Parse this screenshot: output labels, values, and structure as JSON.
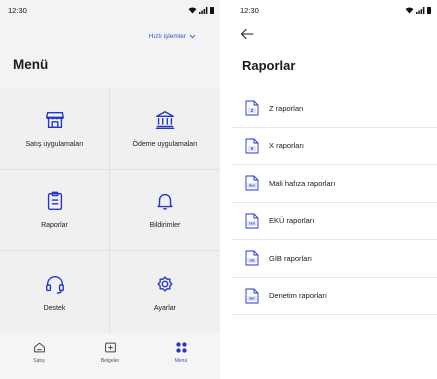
{
  "left_screen": {
    "time": "12:30",
    "quick_actions_label": "Hızlı işlemler",
    "title": "Menü",
    "tiles": [
      {
        "label": "Satış uygulamaları",
        "icon": "store-icon"
      },
      {
        "label": "Ödeme uygulamaları",
        "icon": "bank-icon"
      },
      {
        "label": "Raporlar",
        "icon": "clipboard-icon"
      },
      {
        "label": "Bildirimler",
        "icon": "bell-icon"
      },
      {
        "label": "Destek",
        "icon": "headset-icon"
      },
      {
        "label": "Ayarlar",
        "icon": "gear-icon"
      }
    ],
    "tabs": [
      {
        "label": "Satış",
        "icon": "home-icon",
        "active": false
      },
      {
        "label": "Belgeler",
        "icon": "receipt-icon",
        "active": false
      },
      {
        "label": "Menü",
        "icon": "grid-icon",
        "active": true
      }
    ]
  },
  "right_screen": {
    "time": "12:30",
    "title": "Raporlar",
    "items": [
      {
        "label": "Z raporları",
        "badge": "Z"
      },
      {
        "label": "X raporları",
        "badge": "X"
      },
      {
        "label": "Mali hafıza raporları",
        "badge": "MALİ"
      },
      {
        "label": "EKÜ raporları",
        "badge": "EKÜ"
      },
      {
        "label": "GİB raporları",
        "badge": "GİB"
      },
      {
        "label": "Denetim raporları",
        "badge": "DNT"
      }
    ]
  },
  "colors": {
    "accent": "#3a4fd8",
    "icon_blue": "#2436c8",
    "badge_bg": "#dfe4ff"
  }
}
